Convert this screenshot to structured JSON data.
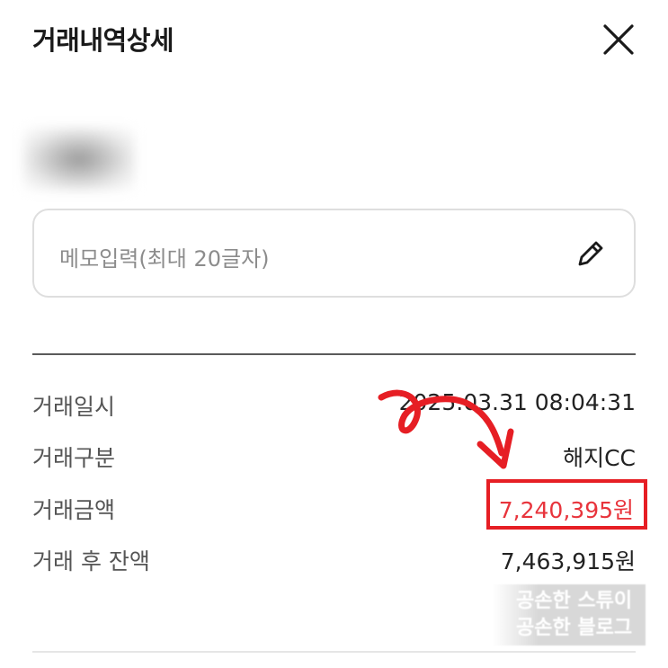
{
  "header": {
    "title": "거래내역상세",
    "close_icon": "close-icon"
  },
  "memo": {
    "placeholder": "메모입력(최대 20글자)",
    "edit_icon": "pencil-icon"
  },
  "details": [
    {
      "label": "거래일시",
      "value": "2025.03.31 08:04:31"
    },
    {
      "label": "거래구분",
      "value": "해지CC"
    },
    {
      "label": "거래금액",
      "value": "7,240,395원"
    },
    {
      "label": "거래 후 잔액",
      "value": "7,463,915원"
    }
  ],
  "watermark": {
    "line1": "공손한 스튜이",
    "line2": "공손한 블로그"
  },
  "colors": {
    "highlight_red": "#e8343c",
    "annotation_red": "#e61e24"
  }
}
